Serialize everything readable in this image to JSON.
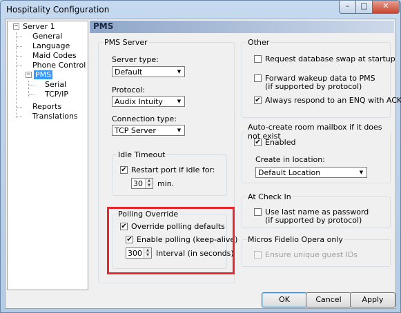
{
  "window": {
    "title": "Hospitality Configuration",
    "minimize": "–",
    "maximize": "□",
    "close": "✕"
  },
  "tree": {
    "root": "Server 1",
    "items": [
      "General",
      "Language",
      "Maid Codes",
      "Phone Control"
    ],
    "pms": "PMS",
    "pms_children": [
      "Serial",
      "TCP/IP"
    ],
    "after": [
      "Reports",
      "Translations"
    ]
  },
  "page_title": "PMS",
  "pms_server": {
    "legend": "PMS Server",
    "server_type_label": "Server type:",
    "server_type_value": "Default",
    "protocol_label": "Protocol:",
    "protocol_value": "Audix Intuity",
    "connection_type_label": "Connection type:",
    "connection_type_value": "TCP Server"
  },
  "idle_timeout": {
    "legend": "Idle Timeout",
    "restart_label": "Restart port if idle for:",
    "restart_checked": true,
    "minutes_value": "30",
    "minutes_unit": "min."
  },
  "polling_override": {
    "legend": "Polling Override",
    "override_label": "Override polling defaults",
    "override_checked": true,
    "enable_label": "Enable polling (keep-alive)",
    "enable_checked": true,
    "interval_value": "300",
    "interval_label": "Interval (in seconds)"
  },
  "other": {
    "legend": "Other",
    "db_swap_label": "Request database swap at startup",
    "db_swap_checked": false,
    "forward_label": "Forward wakeup data to PMS",
    "forward_sub": "(if supported by protocol)",
    "forward_checked": false,
    "enq_label": "Always respond to an ENQ with ACK",
    "enq_checked": true
  },
  "auto_create": {
    "legend": "Auto-create room mailbox if it does not exist",
    "enabled_label": "Enabled",
    "enabled_checked": true,
    "location_label": "Create in location:",
    "location_value": "Default Location"
  },
  "check_in": {
    "legend": "At Check In",
    "last_name_label": "Use last name as password",
    "last_name_sub": "(if supported by protocol)",
    "last_name_checked": false
  },
  "fidelio": {
    "legend": "Micros Fidelio Opera only",
    "unique_label": "Ensure unique guest IDs",
    "unique_checked": false
  },
  "buttons": {
    "ok": "OK",
    "cancel": "Cancel",
    "apply": "Apply"
  },
  "glyphs": {
    "check": "✔",
    "dropdown": "▼",
    "up": "▲",
    "down": "▼",
    "collapse": "−"
  }
}
